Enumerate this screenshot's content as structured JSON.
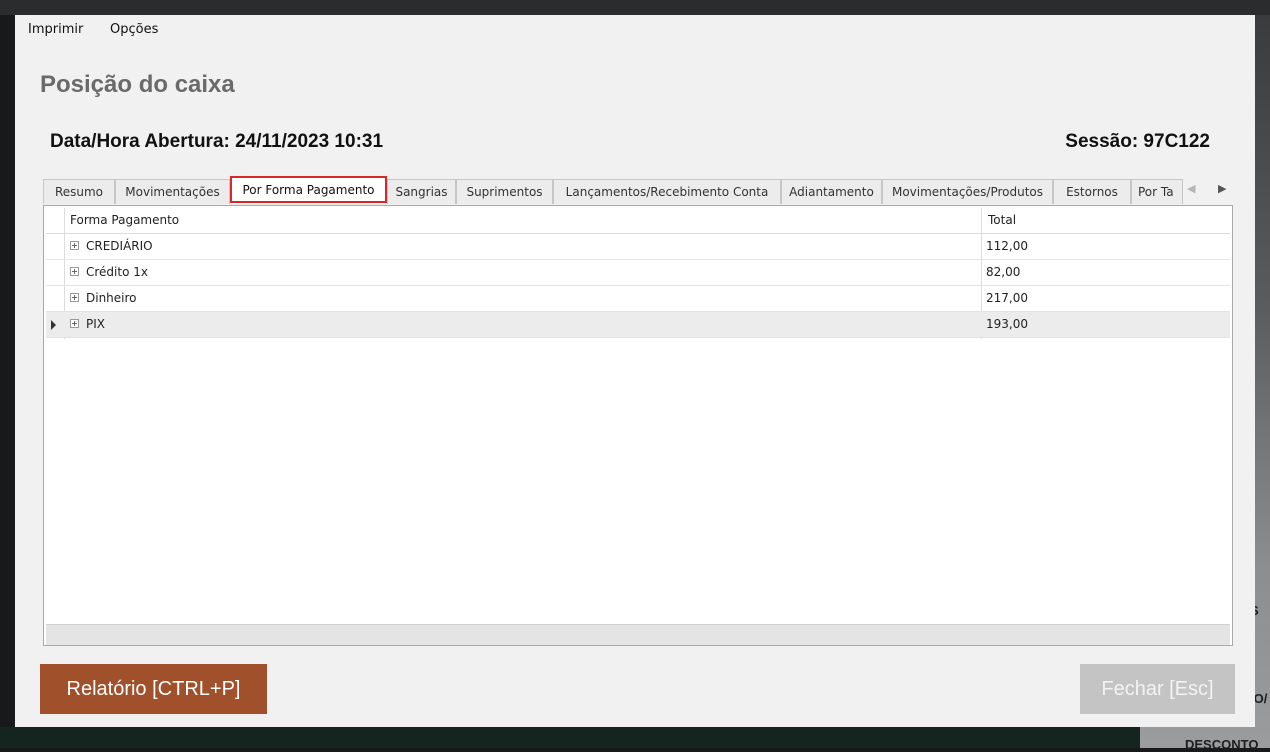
{
  "menu": {
    "items": [
      "Imprimir",
      "Opções"
    ]
  },
  "page": {
    "title": "Posição do caixa",
    "opening": "Data/Hora Abertura: 24/11/2023 10:31",
    "session": "Sessão: 97C122"
  },
  "tabs": [
    "Resumo",
    "Movimentações",
    "Por Forma Pagamento",
    "Sangrias",
    "Suprimentos",
    "Lançamentos/Recebimento Conta",
    "Adiantamento",
    "Movimentações/Produtos",
    "Estornos",
    "Por Ta"
  ],
  "active_tab": "Por Forma Pagamento",
  "grid": {
    "columns": [
      "Forma Pagamento",
      "Total"
    ],
    "rows": [
      {
        "name": "CREDIÁRIO",
        "total": "112,00"
      },
      {
        "name": "Crédito 1x",
        "total": "82,00"
      },
      {
        "name": "Dinheiro",
        "total": "217,00"
      },
      {
        "name": "PIX",
        "total": "193,00"
      }
    ]
  },
  "buttons": {
    "report": "Relatório [CTRL+P]",
    "close": "Fechar [Esc]"
  },
  "background": {
    "right_text_1": "S",
    "right_text_2": "IO/",
    "right_text_3": "DESCONTO"
  },
  "colors": {
    "report_button": "#a0502a",
    "active_tab_outline": "#d9282c",
    "close_button_disabled": "#c4c4c4"
  }
}
